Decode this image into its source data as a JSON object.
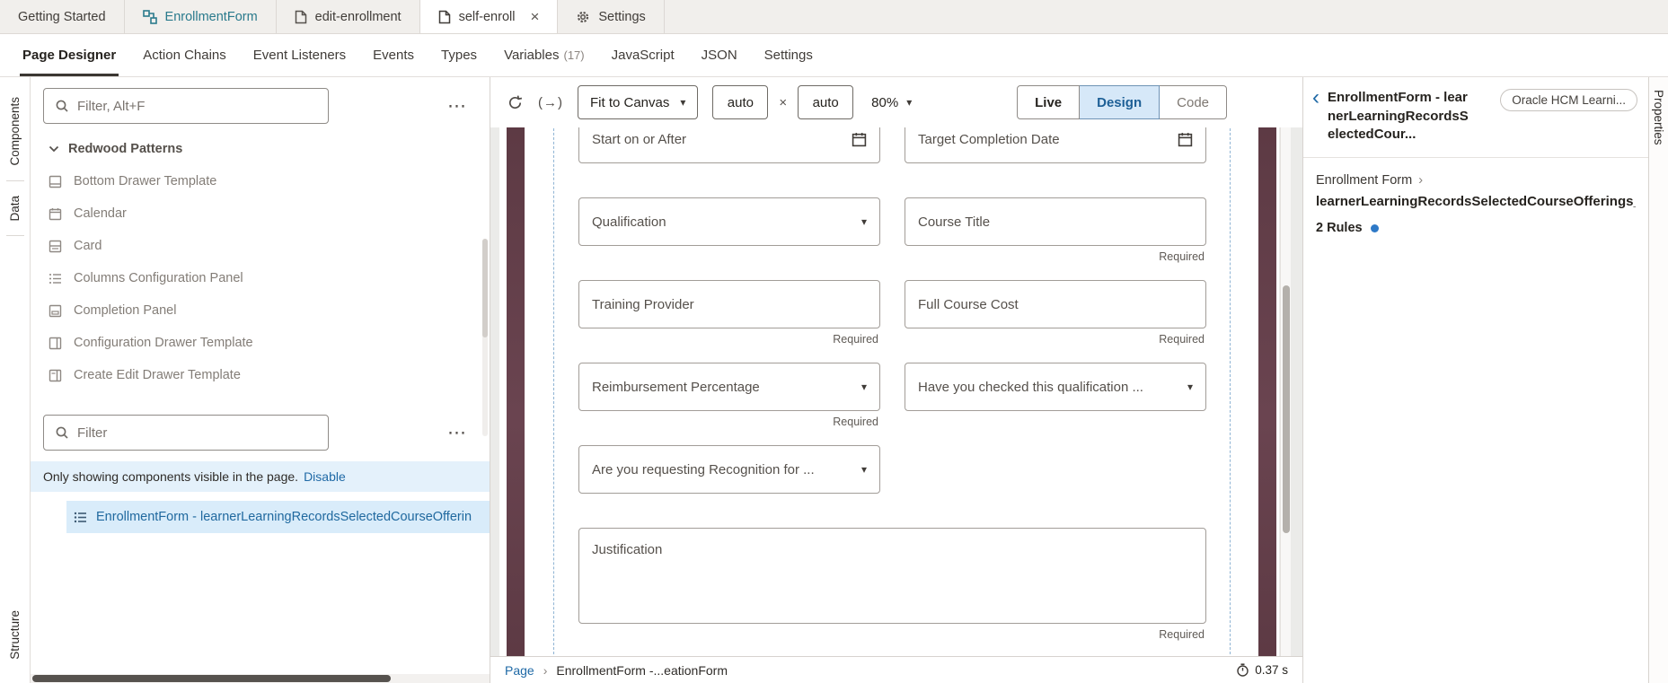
{
  "colors": {
    "accent_link": "#1f69a6",
    "tab_teal": "#2a7a8c",
    "maroon_strip": "#5e3c46",
    "selection_bg": "#d9ecfa",
    "design_active_bg": "#d6e8f8",
    "notice_bg": "#e4f1fb",
    "rules_dot": "#2e79c7"
  },
  "icons": {
    "flow": "svg-flow",
    "page": "svg-document",
    "gear": "svg-gear",
    "close": "×",
    "search": "svg-magnifier",
    "overflow": "⋯",
    "chevron_down": "svg-chevron-down",
    "back_chevron": "‹",
    "breadcrumb_chevron": "›",
    "refresh": "svg-refresh",
    "breakpoint": "(→)",
    "dropdown_caret": "▾",
    "calendar": "svg-calendar",
    "timer": "svg-stopwatch"
  },
  "window_tabs": {
    "close_glyph": "×",
    "items": [
      {
        "label": "Getting Started"
      },
      {
        "label": "EnrollmentForm"
      },
      {
        "label": "edit-enrollment"
      },
      {
        "label": "self-enroll"
      },
      {
        "label": "Settings"
      }
    ]
  },
  "nav": {
    "items": [
      {
        "label": "Page Designer"
      },
      {
        "label": "Action Chains"
      },
      {
        "label": "Event Listeners"
      },
      {
        "label": "Events"
      },
      {
        "label": "Types"
      },
      {
        "label": "Variables",
        "count": "(17)"
      },
      {
        "label": "JavaScript"
      },
      {
        "label": "JSON"
      },
      {
        "label": "Settings"
      }
    ]
  },
  "left_rail": {
    "components": "Components",
    "data": "Data",
    "structure": "Structure"
  },
  "components_panel": {
    "filter_placeholder": "Filter, Alt+F",
    "section": {
      "title": "Redwood Patterns"
    },
    "items": [
      {
        "label": "Bottom Drawer Template"
      },
      {
        "label": "Calendar"
      },
      {
        "label": "Card"
      },
      {
        "label": "Columns Configuration Panel"
      },
      {
        "label": "Completion Panel"
      },
      {
        "label": "Configuration Drawer Template"
      },
      {
        "label": "Create Edit Drawer Template"
      }
    ],
    "page_filter_placeholder": "Filter",
    "notice": {
      "text": "Only showing components visible in the page.",
      "link": "Disable"
    },
    "tree_item": {
      "label": "EnrollmentForm - learnerLearningRecordsSelectedCourseOfferin"
    }
  },
  "canvas_toolbar": {
    "fit_select": {
      "value": "Fit to Canvas"
    },
    "width_input": "auto",
    "multiply_glyph": "×",
    "height_input": "auto",
    "zoom_select": {
      "value": "80%"
    },
    "modes": [
      {
        "label": "Live"
      },
      {
        "label": "Design"
      },
      {
        "label": "Code"
      }
    ]
  },
  "form": {
    "required_label": "Required",
    "fields": [
      {
        "label": "Start on or After"
      },
      {
        "label": "Target Completion Date"
      },
      {
        "label": "Qualification"
      },
      {
        "label": "Course Title"
      },
      {
        "label": "Training Provider"
      },
      {
        "label": "Full Course Cost"
      },
      {
        "label": "Reimbursement Percentage"
      },
      {
        "label": "Have you checked this qualification ..."
      },
      {
        "label": "Are you requesting Recognition for ..."
      },
      {
        "label": "Justification"
      }
    ]
  },
  "canvas_footer": {
    "page_link": "Page",
    "crumb": "EnrollmentForm -...eationForm",
    "timer": "0.37 s"
  },
  "properties_panel": {
    "title": "EnrollmentForm - learnerLearningRecordsSelectedCour...",
    "badge": "Oracle HCM Learni...",
    "breadcrumb": "Enrollment Form",
    "object_name": "learnerLearningRecordsSelectedCourseOfferings_",
    "rules": "2 Rules"
  },
  "right_rail": {
    "label": "Properties"
  }
}
